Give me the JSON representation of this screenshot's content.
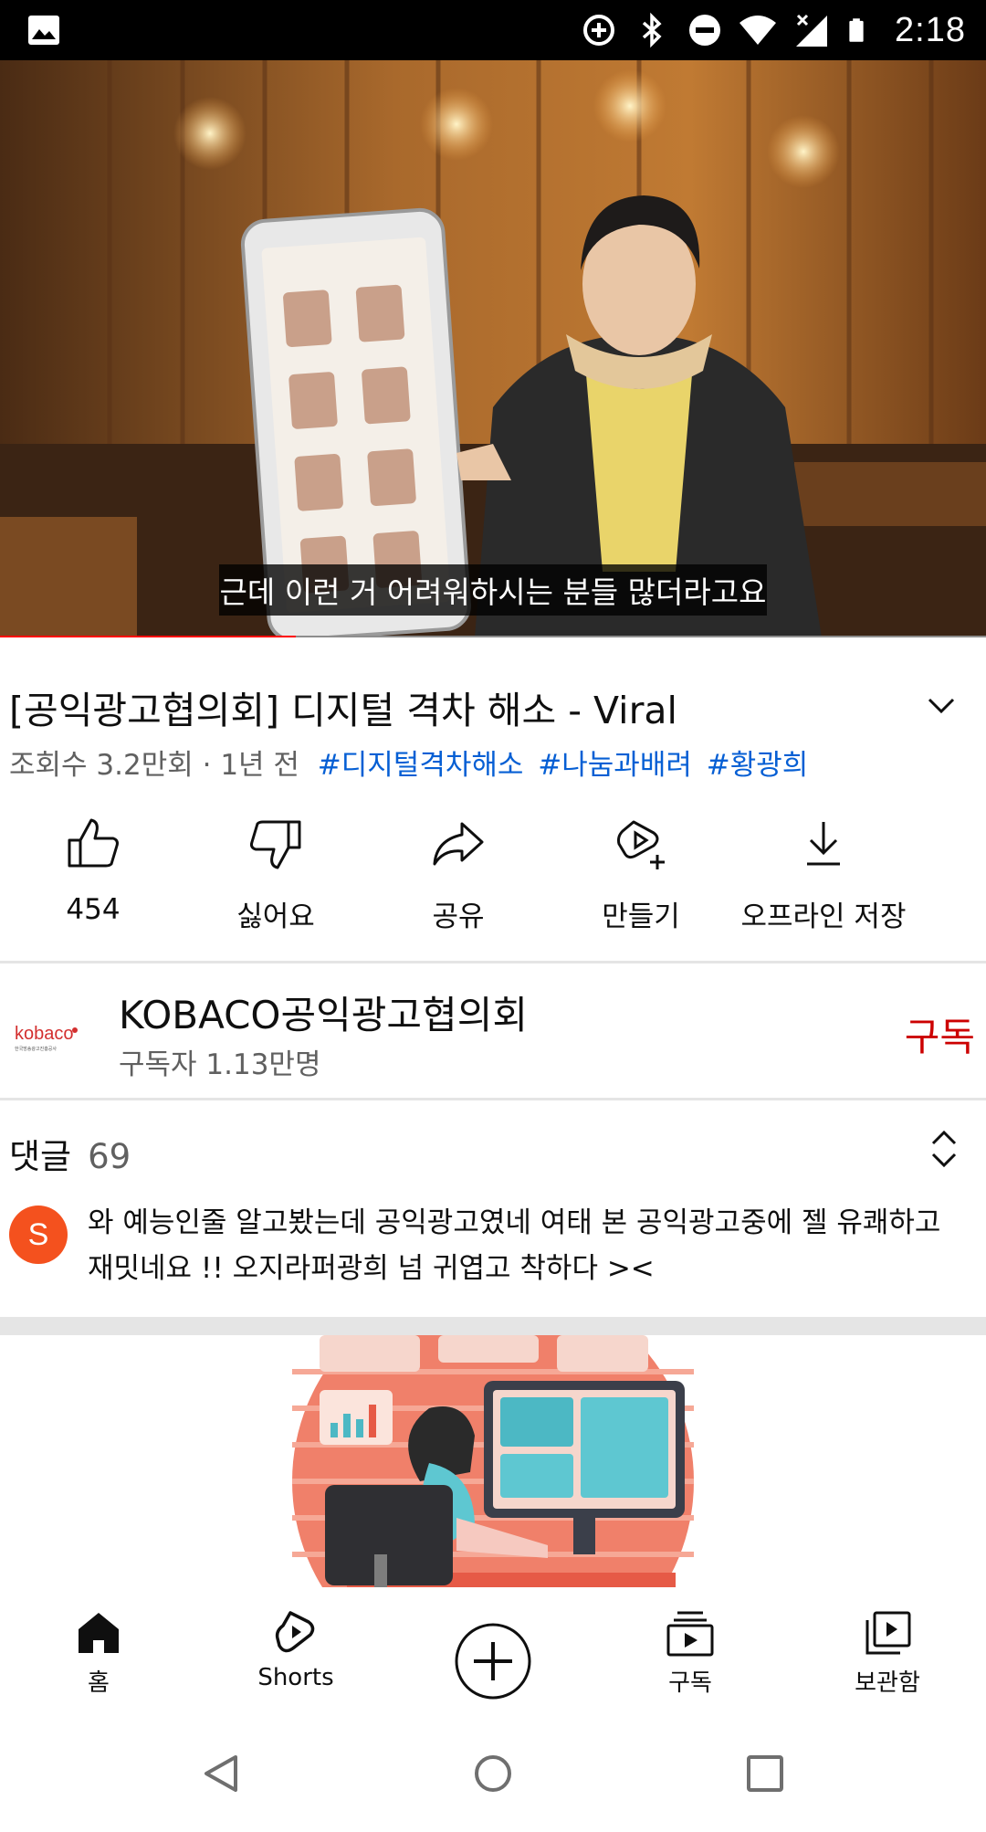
{
  "status_bar": {
    "time": "2:18",
    "icons": [
      "image-icon",
      "data-saver-icon",
      "bluetooth-icon",
      "do-not-disturb-icon",
      "wifi-icon",
      "signal-icon",
      "battery-icon"
    ]
  },
  "video": {
    "subtitle": "근데 이런 거 어려워하시는 분들 많더라고요",
    "progress_fraction": 0.3,
    "progress_color": "#ff0000"
  },
  "title": "[공익광고협의회] 디지털 격차 해소 - Viral",
  "meta": {
    "views": "조회수 3.2만회 · 1년 전",
    "hashtags": [
      "#디지털격차해소",
      "#나눔과배려",
      "#황광희"
    ]
  },
  "actions": [
    {
      "icon": "like-icon",
      "label": "454"
    },
    {
      "icon": "dislike-icon",
      "label": "싫어요"
    },
    {
      "icon": "share-icon",
      "label": "공유"
    },
    {
      "icon": "create-icon",
      "label": "만들기"
    },
    {
      "icon": "download-icon",
      "label": "오프라인 저장"
    }
  ],
  "channel": {
    "logo_text": "kobaco",
    "logo_subtext": "한국방송광고진흥공사",
    "name": "KOBACO공익광고협의회",
    "subscribers": "구독자 1.13만명",
    "subscribe_label": "구독",
    "accent": "#cc0000"
  },
  "comments": {
    "label": "댓글",
    "count": "69",
    "top_comment": {
      "avatar_letter": "S",
      "avatar_color": "#f4511e",
      "text": "와 예능인줄 알고봤는데 공익광고였네 여태 본 공익광고중에 젤 유쾌하고 재밋네요 !! 오지라퍼광희 넘 귀엽고 착하다 ><"
    }
  },
  "bottom_nav": {
    "items": [
      {
        "icon": "home-icon",
        "label": "홈"
      },
      {
        "icon": "shorts-icon",
        "label": "Shorts"
      },
      {
        "icon": "create-plus-icon",
        "label": ""
      },
      {
        "icon": "subscriptions-icon",
        "label": "구독"
      },
      {
        "icon": "library-icon",
        "label": "보관함"
      }
    ]
  }
}
